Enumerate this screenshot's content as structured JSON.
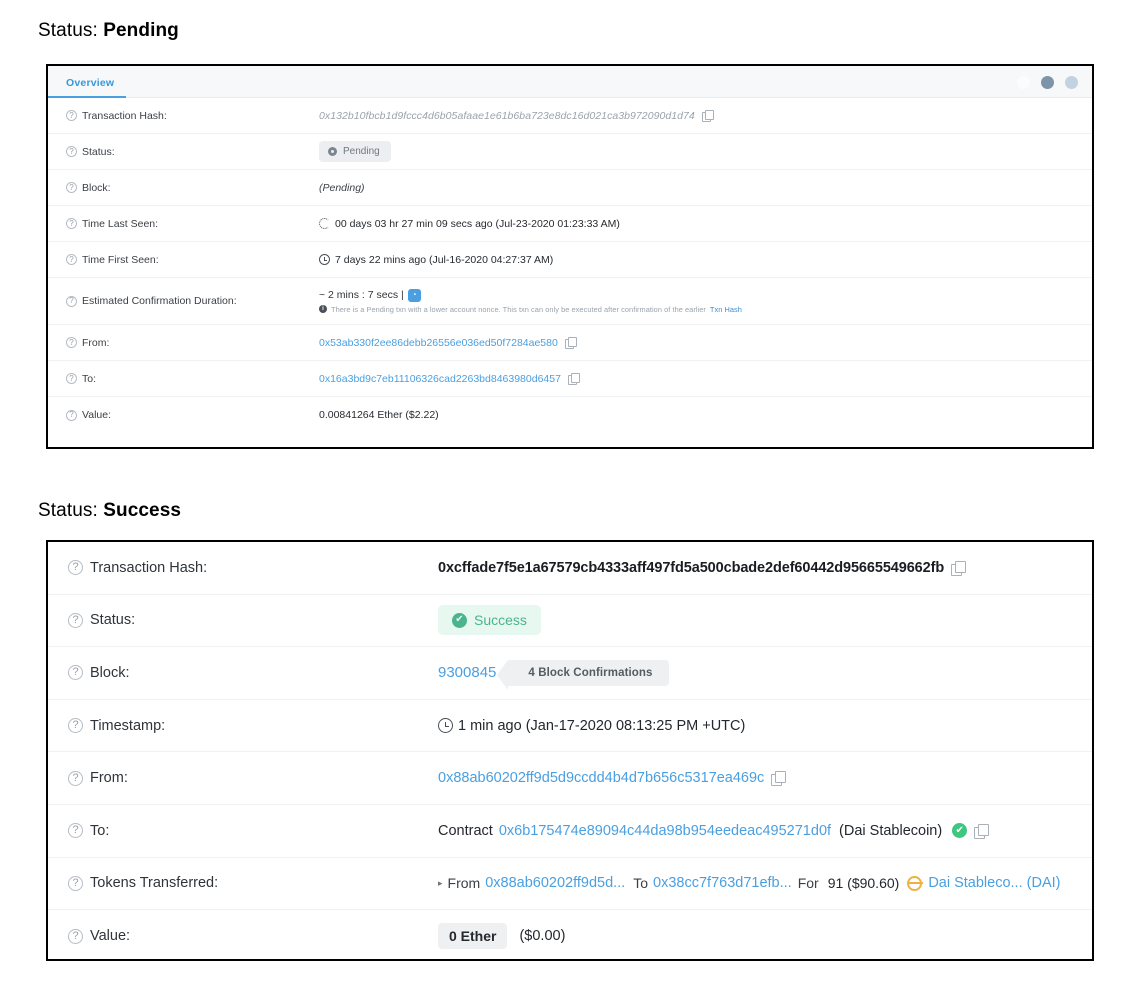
{
  "sections": {
    "pending": {
      "heading_prefix": "Status: ",
      "heading_status": "Pending",
      "tab_label": "Overview",
      "rows": {
        "tx_hash": {
          "label": "Transaction Hash:",
          "value": "0x132b10fbcb1d9fccc4d6b05afaae1e61b6ba723e8dc16d021ca3b972090d1d74"
        },
        "status": {
          "label": "Status:",
          "badge": "Pending"
        },
        "block": {
          "label": "Block:",
          "value": "(Pending)"
        },
        "time_last_seen": {
          "label": "Time Last Seen:",
          "value": "00 days 03 hr 27 min 09 secs ago (Jul-23-2020 01:23:33 AM)"
        },
        "time_first_seen": {
          "label": "Time First Seen:",
          "value": "7 days 22 mins ago (Jul-16-2020 04:27:37 AM)"
        },
        "estimated_confirmation": {
          "label": "Estimated Confirmation Duration:",
          "value": "~ 2 mins : 7 secs |",
          "note": "There is a Pending txn with a lower account nonce. This txn can only be executed after confirmation of the earlier",
          "note_link": "Txn Hash"
        },
        "from": {
          "label": "From:",
          "value": "0x53ab330f2ee86debb26556e036ed50f7284ae580"
        },
        "to": {
          "label": "To:",
          "value": "0x16a3bd9c7eb11106326cad2263bd8463980d6457"
        },
        "value": {
          "label": "Value:",
          "value": "0.00841264 Ether ($2.22)"
        }
      }
    },
    "success": {
      "heading_prefix": "Status: ",
      "heading_status": "Success",
      "rows": {
        "tx_hash": {
          "label": "Transaction Hash:",
          "value": "0xcffade7f5e1a67579cb4333aff497fd5a500cbade2def60442d95665549662fb"
        },
        "status": {
          "label": "Status:",
          "badge": "Success"
        },
        "block": {
          "label": "Block:",
          "value": "9300845",
          "confirmations": "4 Block Confirmations"
        },
        "timestamp": {
          "label": "Timestamp:",
          "value": "1 min ago (Jan-17-2020 08:13:25 PM +UTC)"
        },
        "from": {
          "label": "From:",
          "value": "0x88ab60202ff9d5d9ccdd4b4d7b656c5317ea469c"
        },
        "to": {
          "label": "To:",
          "prefix": "Contract",
          "address": "0x6b175474e89094c44da98b954eedeac495271d0f",
          "name": "(Dai Stablecoin)"
        },
        "tokens_transferred": {
          "label": "Tokens Transferred:",
          "caret": "▸",
          "from_word": "From",
          "from_addr": "0x88ab60202ff9d5d...",
          "to_word": "To",
          "to_addr": "0x38cc7f763d71efb...",
          "for_word": "For",
          "amount": "91 ($90.60)",
          "token_name": "Dai Stableco... (DAI)"
        },
        "value": {
          "label": "Value:",
          "ether": "0 Ether",
          "usd": "($0.00)"
        }
      }
    }
  },
  "colors": {
    "link_blue": "#4a9fe0",
    "success_green": "#4cb48c",
    "success_bg": "#e6f8f0",
    "pending_gray": "#717880",
    "pending_bg": "#eceef1",
    "dai_orange": "#f0b23c",
    "border_black": "#000000"
  },
  "icons": {
    "help": "?",
    "copy": "copy-icon",
    "check": "✔",
    "info": "i",
    "gauge": "◔"
  }
}
